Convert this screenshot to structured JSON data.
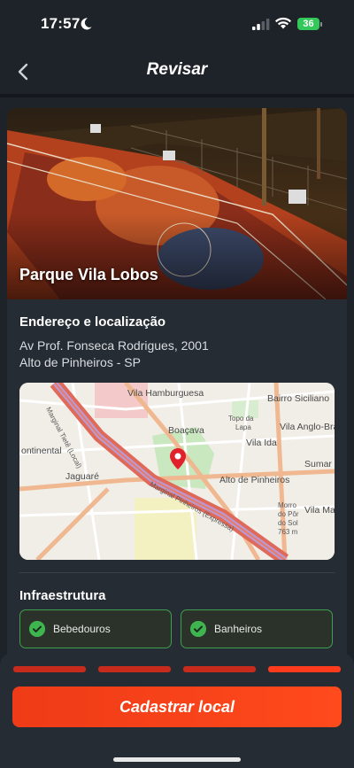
{
  "status_bar": {
    "time": "17:57",
    "battery": "36"
  },
  "nav": {
    "title": "Revisar"
  },
  "place": {
    "name": "Parque Vila Lobos"
  },
  "address": {
    "section_title": "Endereço e localização",
    "line1": "Av Prof. Fonseca Rodrigues, 2001",
    "line2": "Alto de Pinheiros - SP"
  },
  "map": {
    "labels": [
      "Vila Hamburguesa",
      "Bairro Siciliano",
      "Topo da",
      "Lapa",
      "Boaçava",
      "Vila Anglo-Bra",
      "Vila Ida",
      "Sumar",
      "ontinental",
      "Jaguaré",
      "Alto de Pinheiros",
      "Morro",
      "do Pôr",
      "do Sol",
      "763 m",
      "Vila Ma",
      "Marginal Tietê (Local)",
      "Marginal Pinheiros (Expressa)"
    ]
  },
  "infra": {
    "section_title": "Infraestrutura",
    "items": [
      "Bebedouros",
      "Banheiros"
    ]
  },
  "progress": {
    "total_steps": 4,
    "current_step": 4
  },
  "cta": {
    "label": "Cadastrar local"
  },
  "colors": {
    "accent": "#ff3b1e",
    "success": "#3eb54f",
    "background": "#1e2329"
  }
}
